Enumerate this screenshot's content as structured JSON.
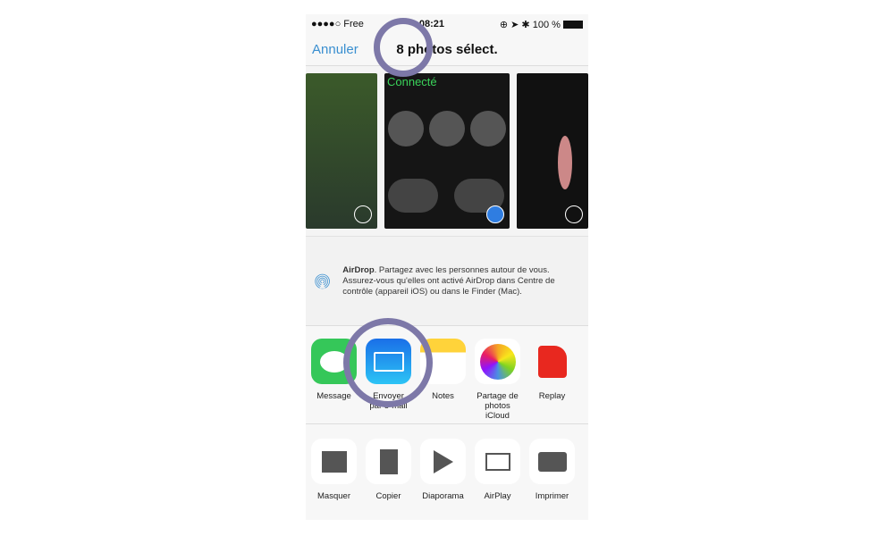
{
  "status": {
    "carrier": "●●●●○ Free",
    "time": "08:21",
    "battery": "100 %"
  },
  "nav": {
    "cancel": "Annuler",
    "title": "8 photos sélect."
  },
  "photos": [
    {
      "selected": false
    },
    {
      "selected": true,
      "caption": "Connecté"
    },
    {
      "selected": false
    }
  ],
  "airdrop": {
    "title": "AirDrop",
    "text": ". Partagez avec les personnes autour de vous. Assurez-vous qu'elles ont activé AirDrop dans Centre de contrôle (appareil iOS) ou dans le Finder (Mac)."
  },
  "apps": [
    {
      "label": "Message",
      "icon": "messages-icon",
      "color": "#35c759"
    },
    {
      "label": "Envoyer par e-mail",
      "icon": "mail-icon",
      "color": "#1e8ff0"
    },
    {
      "label": "Notes",
      "icon": "notes-icon",
      "color": "#ffd33a"
    },
    {
      "label": "Partage de photos iCloud",
      "icon": "photos-icon",
      "color": "#ffffff"
    },
    {
      "label": "Replay",
      "icon": "replay-icon",
      "color": "#e8281f"
    }
  ],
  "actions": [
    {
      "label": "Masquer",
      "icon": "hide-icon"
    },
    {
      "label": "Copier",
      "icon": "copy-icon"
    },
    {
      "label": "Diaporama",
      "icon": "play-icon"
    },
    {
      "label": "AirPlay",
      "icon": "airplay-icon"
    },
    {
      "label": "Imprimer",
      "icon": "print-icon"
    }
  ]
}
